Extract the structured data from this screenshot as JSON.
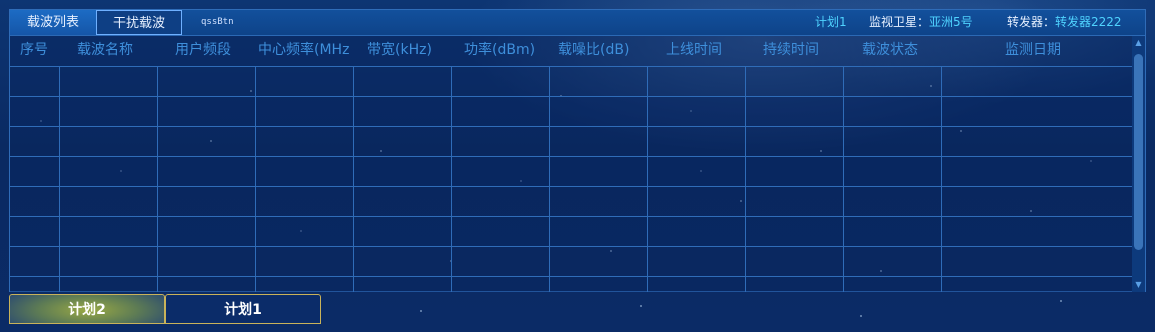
{
  "toolbar": {
    "tab_carrier_list": "载波列表",
    "tab_interference": "干扰载波",
    "qss_button": "qssBtn"
  },
  "info": {
    "plan": "计划1",
    "satellite_label": "监视卫星：",
    "satellite_value": "亚洲5号",
    "transponder_label": "转发器：",
    "transponder_value": "转发器2222"
  },
  "table": {
    "columns": [
      "序号",
      "载波名称",
      "用户频段",
      "中心频率(MHz",
      "带宽(kHz)",
      "功率(dBm)",
      "载噪比(dB)",
      "上线时间",
      "持续时间",
      "载波状态",
      "监测日期"
    ],
    "rows": []
  },
  "bottom_tabs": [
    "计划2",
    "计划1"
  ],
  "colors": {
    "accent": "#4fd3ff",
    "header_text": "#3e8fdb",
    "grid_line": "#2f6cb8",
    "background": "#0b2a63"
  }
}
